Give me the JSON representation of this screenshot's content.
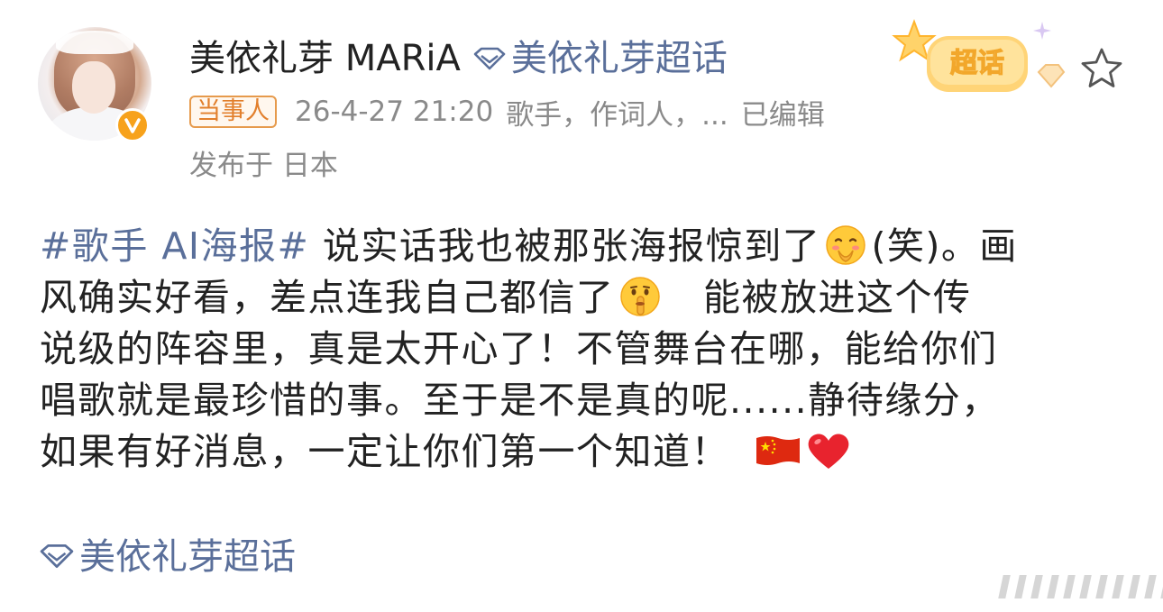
{
  "post": {
    "username": "美依礼芽 MARiA",
    "supertopic_link": "美依礼芽超话",
    "badge": "当事人",
    "datetime": "26-4-27 21:20",
    "bio": "歌手，作词人，...",
    "edited": "已编辑",
    "location": "发布于 日本",
    "supertopic_badge_text": "超话",
    "content": {
      "line1_hashtag": "#歌手 AI海报#",
      "line1_text_a": " 说实话我也被那张海报惊到了",
      "line1_text_b": "(笑)。画",
      "line2_text_a": "风确实好看，差点连我自己都信了",
      "line2_text_b": "　能被放进这个传",
      "line3": "说级的阵容里，真是太开心了！不管舞台在哪，能给你们",
      "line4": "唱歌就是最珍惜的事。至于是不是真的呢......静待缘分，",
      "line5": "如果有好消息，一定让你们第一个知道！"
    },
    "footer_topic": "美依礼芽超话"
  },
  "icons": {
    "emoji_1": "blushing-hand-over-mouth-emoji",
    "emoji_2": "shushing-face-emoji",
    "emoji_3": "china-flag-emoji",
    "emoji_4": "red-heart-emoji",
    "verified": "verified-orange-badge-icon",
    "diamond": "supertopic-diamond-icon",
    "star": "star-outline-icon"
  },
  "colors": {
    "link": "#5a6f9a",
    "badge_orange": "#e27f2c",
    "verified": "#f7a21c",
    "meta_gray": "#8a8a8a"
  }
}
